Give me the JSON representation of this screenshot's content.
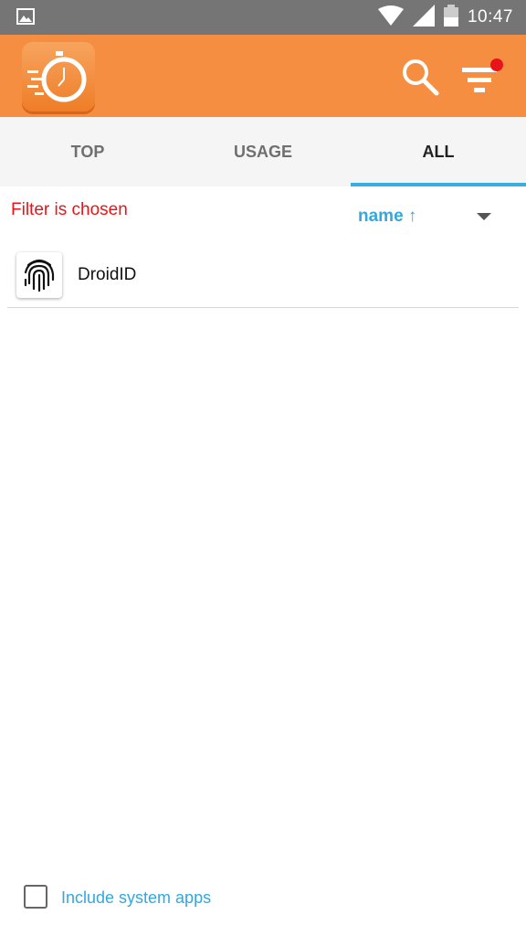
{
  "status_bar": {
    "time": "10:47",
    "icons": [
      "image-icon",
      "wifi-icon",
      "signal-icon",
      "battery-icon"
    ]
  },
  "app_bar": {
    "logo_icon": "stopwatch-icon",
    "search_icon": "search-icon",
    "filter_icon": "filter-icon",
    "filter_indicator_color": "#e8141a",
    "background_color": "#f58e40"
  },
  "tabs": [
    {
      "label": "TOP",
      "active": false
    },
    {
      "label": "USAGE",
      "active": false
    },
    {
      "label": "ALL",
      "active": true
    }
  ],
  "filter_status": "Filter is chosen",
  "sort": {
    "label": "name ↑"
  },
  "apps": [
    {
      "name": "DroidID",
      "icon": "fingerprint-icon"
    }
  ],
  "system_apps": {
    "label": "Include system apps",
    "checked": false
  },
  "accent_color": "#33a8de"
}
